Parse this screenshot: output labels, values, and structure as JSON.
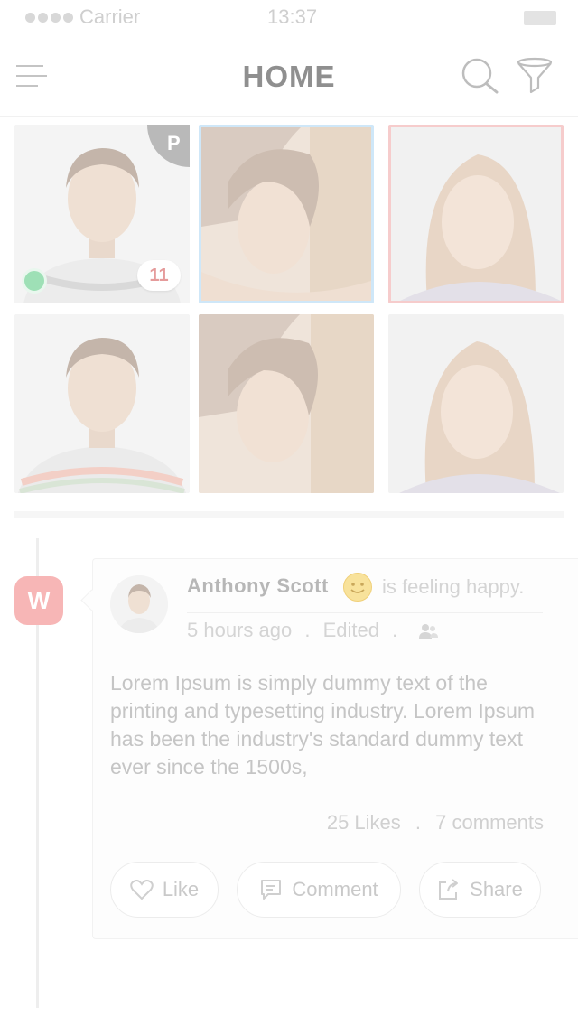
{
  "status_bar": {
    "carrier": "Carrier",
    "time": "13:37"
  },
  "header": {
    "title": "HOME",
    "menu_icon": "hamburger-menu-icon",
    "search_icon": "search-icon",
    "filter_icon": "filter-icon"
  },
  "grid": {
    "premium_badge": "P",
    "message_count": "11",
    "tiles": [
      {
        "name": "profile-tile-1",
        "accent": "none"
      },
      {
        "name": "profile-tile-2",
        "accent": "#cfe7f8"
      },
      {
        "name": "profile-tile-3",
        "accent": "#f6cccc"
      },
      {
        "name": "profile-tile-4",
        "accent": "none"
      },
      {
        "name": "profile-tile-5",
        "accent": "none"
      },
      {
        "name": "profile-tile-6",
        "accent": "none"
      }
    ]
  },
  "timeline": {
    "badge_label": "W"
  },
  "post": {
    "author": "Anthony Scott",
    "feeling": "is feeling happy.",
    "time_ago": "5 hours ago",
    "separator": ".",
    "edited": "Edited",
    "body": "Lorem Ipsum is simply dummy text of the printing and typesetting industry. Lorem Ipsum has been the industry's standard dummy text ever since the 1500s,",
    "likes": "25 Likes",
    "comments": "7 comments",
    "actions": {
      "like": "Like",
      "comment": "Comment",
      "share": "Share"
    }
  },
  "colors": {
    "accent_blue": "#cfe7f8",
    "accent_red": "#f6cccc",
    "badge_red": "#f7b6b6",
    "online_green": "#9ee0b6"
  }
}
